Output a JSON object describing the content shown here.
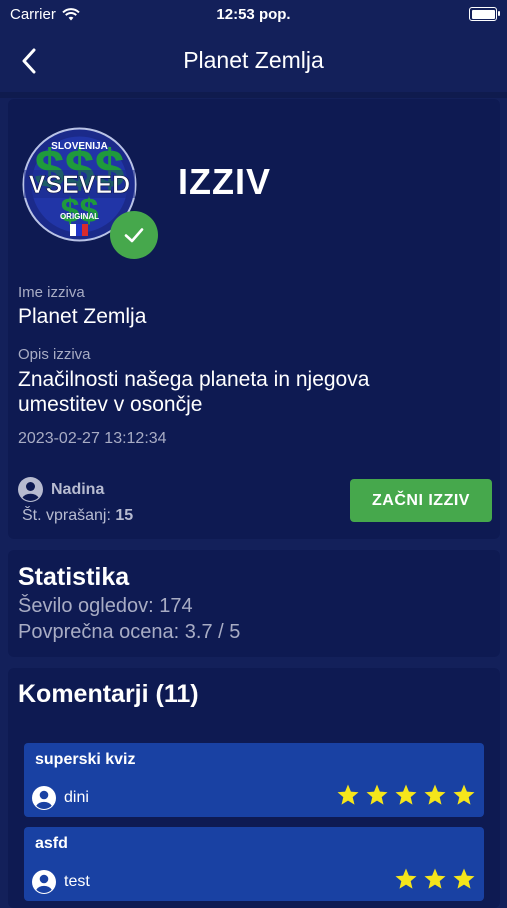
{
  "status_bar": {
    "carrier": "Carrier",
    "time": "12:53 pop."
  },
  "nav": {
    "title": "Planet Zemlja"
  },
  "challenge": {
    "logo_texts": {
      "top": "SLOVENIJA",
      "main": "VSEVED",
      "bottom": "ORIGINAL"
    },
    "heading": "IZZIV",
    "name_label": "Ime izziva",
    "name_value": "Planet Zemlja",
    "desc_label": "Opis izziva",
    "desc_value": "Značilnosti našega planeta in njegova umestitev v osončje",
    "date": "2023-02-27 13:12:34",
    "author": "Nadina",
    "questions_label": "Št. vprašanj:",
    "questions_value": "15",
    "start_button": "ZAČNI IZZIV",
    "completed": true
  },
  "stats": {
    "title": "Statistika",
    "views": "Ševilo ogledov: 174",
    "rating": "Povprečna ocena: 3.7 / 5"
  },
  "comments": {
    "title": "Komentarji (11)",
    "items": [
      {
        "text": "superski kviz",
        "user": "dini",
        "rating": 5
      },
      {
        "text": "asfd",
        "user": "test",
        "rating": 3
      }
    ]
  },
  "colors": {
    "background": "#13205a",
    "card": "#0e1a52",
    "accent_green": "#46a84c",
    "comment_bg": "#1941a3",
    "star": "#f5e51b"
  }
}
